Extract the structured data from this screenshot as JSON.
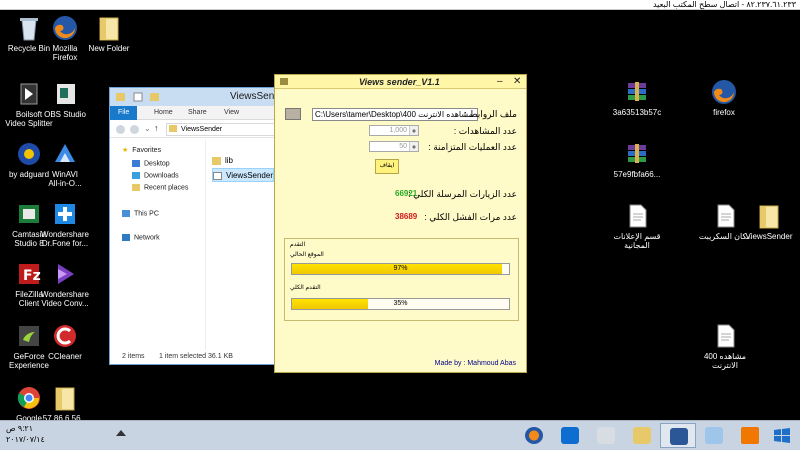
{
  "rdp": {
    "title": "٨٢.٢٣٧.٦١.٢٣٣ - اتصال سطح المكتب البعيد"
  },
  "desktop_left": [
    {
      "label": "Recycle Bin",
      "icon": "recycle-bin-icon"
    },
    {
      "label": "Mozilla\nFirefox",
      "icon": "firefox-icon"
    },
    {
      "label": "New Folder",
      "icon": "folder-icon"
    },
    {
      "label": "Boilsoft\nVideo Splitter",
      "icon": "video-splitter-icon"
    },
    {
      "label": "OBS Studio",
      "icon": "obs-icon"
    },
    {
      "label": "by adguard",
      "icon": "adguard-icon"
    },
    {
      "label": "WinAVI\nAll-in-O...",
      "icon": "winavi-icon"
    },
    {
      "label": "Camtasia\nStudio 8",
      "icon": "camtasia-icon"
    },
    {
      "label": "Wondershare\nDr.Fone for...",
      "icon": "drfone-icon"
    },
    {
      "label": "FileZilla\nClient",
      "icon": "filezilla-icon"
    },
    {
      "label": "Wondershare\nVideo Conv...",
      "icon": "video-converter-icon"
    },
    {
      "label": "GeForce\nExperience",
      "icon": "geforce-icon"
    },
    {
      "label": "CCleaner",
      "icon": "ccleaner-icon"
    },
    {
      "label": "Google",
      "icon": "chrome-icon"
    },
    {
      "label": "57.86.6.56...",
      "icon": "folder-icon"
    }
  ],
  "desktop_right": [
    {
      "label": "3a63513b57c",
      "icon": "winrar-icon"
    },
    {
      "label": "firefox",
      "icon": "firefox-icon"
    },
    {
      "label": "57e9fbfa66...",
      "icon": "winrar-icon"
    },
    {
      "label": "قسم الإعلانات\nالمجانية",
      "icon": "document-icon"
    },
    {
      "label": "مكان السكريبت",
      "icon": "document-icon"
    },
    {
      "label": "ViewsSender",
      "icon": "folder-icon"
    },
    {
      "label": "مشاهده 400\nالانترنت",
      "icon": "document-icon"
    }
  ],
  "explorer": {
    "title": "ViewsSender",
    "tabs": [
      "File",
      "Home",
      "Share",
      "View"
    ],
    "address": "ViewsSender",
    "nav": {
      "favorites": "Favorites",
      "desktop": "Desktop",
      "downloads": "Downloads",
      "recent": "Recent places",
      "this_pc": "This PC",
      "network": "Network"
    },
    "files": [
      "lib",
      "ViewsSender"
    ],
    "status_items": "2 items",
    "status_selected": "1 item selected",
    "status_size": "36.1 KB"
  },
  "vs": {
    "title": "Views sender_V1.1",
    "links_label": "ملف الروابط :",
    "path_value": "C:\\Users\\tamer\\Desktop\\مشاهده الانترنت 400",
    "views_label": "عدد المشاهدات :",
    "views_value": "1,000",
    "parallel_label": "عدد العمليات المتزامنة :",
    "parallel_value": "50",
    "stop_label": "ايقاف",
    "total_sent_label": "عدد الزيارات المرسلة الكلي :",
    "total_sent_value": "66921",
    "total_fail_label": "عدد مرات الفشل الكلي :",
    "total_fail_value": "38689",
    "group_label": "التقدم",
    "site_progress_label": "الموقع الحالي",
    "site_progress_value": "97%",
    "site_progress_fraction": 0.97,
    "total_progress_label": "التقدم الكلي",
    "total_progress_value": "35%",
    "total_progress_fraction": 0.35,
    "credit": "Made by : Mahmoud Abas"
  },
  "taskbar": {
    "time": "٩:٢١ ص",
    "date": "٢٠١٧/٠٧/١٤",
    "apps": [
      "firefox-icon",
      "teamviewer-icon",
      "settings-icon",
      "file-explorer-icon",
      "remote-desktop-icon",
      "notepad-icon",
      "vlc-icon",
      "windows-icon"
    ]
  },
  "colors": {
    "sent": "#22aa22",
    "fail": "#d11a1a",
    "progress": "#ffd800",
    "credit": "#00008b"
  }
}
